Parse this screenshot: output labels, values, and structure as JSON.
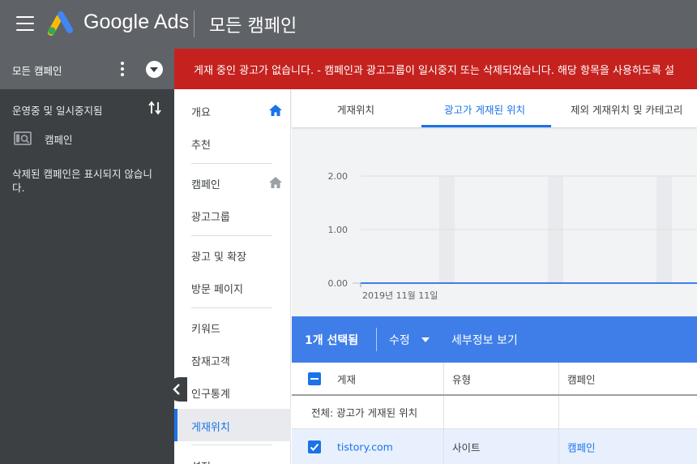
{
  "app": {
    "brand": "Google Ads",
    "page_title": "모든 캠페인"
  },
  "left_panel": {
    "header_label": "모든 캠페인",
    "filter_label": "운영중 및 일시중지됨",
    "campaign_label": "캠페인",
    "deleted_note": "삭제된 캠페인은 표시되지 않습니다."
  },
  "banner": {
    "message": "게재 중인 광고가 없습니다. - 캠페인과 광고그룹이 일시중지 또는 삭제되었습니다. 해당 항목을 사용하도록 설"
  },
  "nav": {
    "items": [
      {
        "label": "개요"
      },
      {
        "label": "추천"
      },
      {
        "label": "캠페인"
      },
      {
        "label": "광고그룹"
      },
      {
        "label": "광고 및 확장"
      },
      {
        "label": "방문 페이지"
      },
      {
        "label": "키워드"
      },
      {
        "label": "잠재고객"
      },
      {
        "label": "인구통계"
      },
      {
        "label": "게재위치"
      },
      {
        "label": "설정"
      }
    ]
  },
  "tabs": [
    {
      "label": "게재위치"
    },
    {
      "label": "광고가 게재된 위치"
    },
    {
      "label": "제외 게재위치 및 카테고리"
    }
  ],
  "chart_data": {
    "type": "line",
    "y_ticks": [
      "2.00",
      "1.00",
      "0.00"
    ],
    "ylim": [
      0,
      2
    ],
    "x_label_start": "2019년 11월 11일",
    "series": [
      {
        "values": [
          0,
          0,
          0,
          0,
          0,
          0,
          0
        ]
      }
    ],
    "colors": {
      "line": "#3f7ee8",
      "weekend_band": "#e8eaed"
    }
  },
  "actionbar": {
    "selected": "1개 선택됨",
    "edit": "수정",
    "details": "세부정보 보기"
  },
  "table": {
    "headers": [
      "게재",
      "유형",
      "캠페인"
    ],
    "summary": "전체: 광고가 게재된 위치",
    "rows": [
      {
        "placement": "tistory.com",
        "type": "사이트",
        "campaign": "캠페인"
      }
    ]
  },
  "colors": {
    "accent": "#1a73e8",
    "banner": "#c5221f",
    "topbar": "#5f6368",
    "sidebar": "#3c4043"
  }
}
